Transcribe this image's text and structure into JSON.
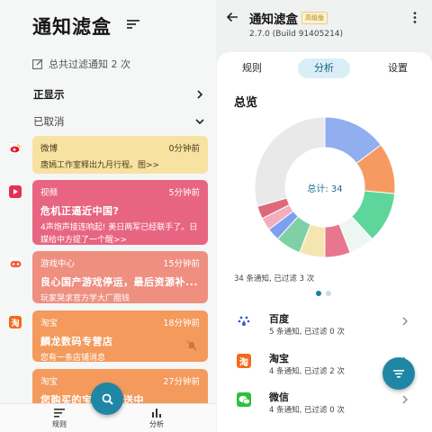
{
  "left": {
    "title": "通知滤盒",
    "total_filtered": "总共过滤通知 2 次",
    "section_showing": "正显示",
    "section_cancelled": "已取消",
    "notifications": [
      {
        "app": "微博",
        "time": "0分钟前",
        "title": "",
        "body": "唐嫣工作室释出九月行程。图>>",
        "color": "#f8e2a2"
      },
      {
        "app": "视频",
        "time": "5分钟前",
        "title": "危机正逼近中国?",
        "body": "4声炮声接连响起! 美日两军已经联手了。日媒给中方提了一个醒>>",
        "color": "#e86581"
      },
      {
        "app": "游戏中心",
        "time": "15分钟前",
        "title": "良心国产游戏停运，最后资源补...",
        "body": "玩家哭求官方学大厂圈钱",
        "color": "#ee8f80"
      },
      {
        "app": "淘宝",
        "time": "18分钟前",
        "title": "麟龙数码专营店",
        "body": "您有一条店铺消息",
        "color": "#f39a5c"
      },
      {
        "app": "淘宝",
        "time": "27分钟前",
        "title": "您购买的宝贝已发送中",
        "body": "",
        "color": "#f39a5c"
      }
    ],
    "nav": {
      "rules": "规则",
      "analysis": "分析"
    }
  },
  "right": {
    "title": "通知滤盒",
    "badge": "高级版",
    "version": "2.7.0  (Build 91405214)",
    "tabs": {
      "rules": "规则",
      "analysis": "分析",
      "settings": "设置"
    },
    "overview": "总览",
    "total_label": "总计: 34",
    "summary": "34 条通知, 已过滤 3 次",
    "apps": [
      {
        "name": "百度",
        "sub": "5 条通知, 已过滤 0 次"
      },
      {
        "name": "淘宝",
        "sub": "4 条通知, 已过滤 2 次"
      },
      {
        "name": "微信",
        "sub": "4 条通知, 已过滤 0 次"
      }
    ]
  },
  "colors": {
    "accent": "#1f86a6",
    "weibo": "#f8e2a2",
    "video": "#e86581",
    "game": "#ee8f80",
    "taobao": "#f39a5c"
  },
  "chart_data": {
    "type": "pie",
    "values": [
      5,
      4,
      4,
      2,
      2,
      2,
      2,
      1,
      1,
      1,
      10
    ],
    "colors": [
      "#90aef0",
      "#f79a62",
      "#5ed59a",
      "#eef6f2",
      "#e8768c",
      "#f5e5b1",
      "#7fd0a4",
      "#7d9ff0",
      "#f2aebc",
      "#dd6a7a",
      "#e9e9e9"
    ]
  }
}
